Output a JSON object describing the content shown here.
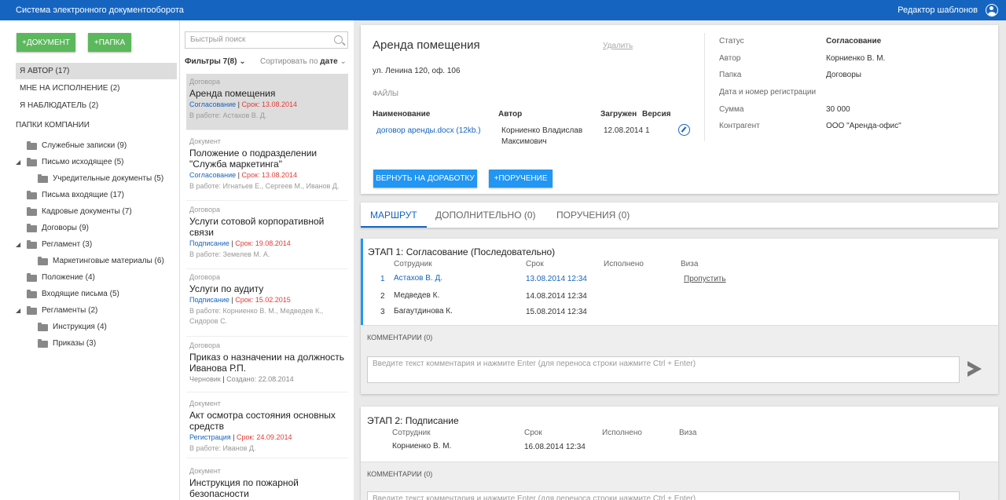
{
  "app": {
    "title": "Система электронного документооборота",
    "template_editor": "Редактор шаблонов"
  },
  "colors": {
    "primary": "#1565c0",
    "green": "#5cb85c",
    "accent": "#2196f3",
    "deadline": "#e53935"
  },
  "sidebar": {
    "add_document": "+ДОКУМЕНТ",
    "add_folder": "+ПАПКА",
    "nav": [
      "Я АВТОР (17)",
      "МНЕ НА ИСПОЛНЕНИЕ (2)",
      "Я НАБЛЮДАТЕЛЬ (2)"
    ],
    "section_title": "ПАПКИ КОМПАНИИ",
    "folders": [
      "Служебные записки (9)",
      "Письмо исходящее (5)",
      "Учредительные документы (5)",
      "Письма входящие (17)",
      "Кадровые документы (7)",
      "Договоры (9)",
      "Регламент (3)",
      "Маркетинговые материалы (6)",
      "Положение (4)",
      "Входящие письма (5)",
      "Регламенты (2)",
      "Инструкция (4)",
      "Приказы (3)"
    ]
  },
  "list": {
    "search_placeholder": "Быстрый поиск",
    "filters": "Фильтры 7(8)",
    "filters_caret": "⌄",
    "sort_label": "Сортировать по",
    "sort_field": "дате",
    "sort_caret": "⌄",
    "items": [
      {
        "type": "Договора",
        "title": "Аренда помещения",
        "status": "Согласование",
        "deadline": "Срок: 13.08.2014",
        "meta": "В работе: Астахов В. Д."
      },
      {
        "type": "Документ",
        "title": "Положение о подразделении \"Служба маркетинга\"",
        "status": "Согласование",
        "deadline": "Срок: 13.08.2014",
        "meta": "В работе: Игнатьев Е., Сергеев М., Иванов Д."
      },
      {
        "type": "Договора",
        "title": "Услуги сотовой корпоративной связи",
        "status": "Подписание",
        "deadline": "Срок: 19.08.2014",
        "meta": "В работе: Земелев М. А."
      },
      {
        "type": "Договора",
        "title": "Услуги по аудиту",
        "status": "Подписание",
        "deadline": "Срок: 15.02.2015",
        "meta": "В работе: Корниенко В. М., Медведев К., Сидоров С."
      },
      {
        "type": "Договора",
        "title": "Приказ о назначении на должность Иванова Р.П.",
        "status": "Черновик",
        "deadline": "Создано: 22.08.2014",
        "meta": ""
      },
      {
        "type": "Документ",
        "title": "Акт осмотра состояния основных средств",
        "status": "Регистрация",
        "deadline": "Срок: 24.09.2014",
        "meta": "В работе: Иванов Д."
      },
      {
        "type": "Документ",
        "title": "Инструкция по пожарной безопасности",
        "status": "",
        "deadline": "",
        "meta": ""
      }
    ]
  },
  "doc": {
    "title": "Аренда помещения",
    "delete": "Удалить",
    "address": "ул. Ленина 120, оф. 106",
    "files_label": "ФАЙЛЫ",
    "files_headers": {
      "name": "Наименование",
      "author": "Автор",
      "uploaded": "Загружен",
      "version": "Версия"
    },
    "file": {
      "name": "договор аренды.docx (12kb.)",
      "author": "Корниенко Владислав Максимович",
      "uploaded": "12.08.2014",
      "version": "1"
    },
    "return_btn": "ВЕРНУТЬ НА ДОРАБОТКУ",
    "task_btn": "+ПОРУЧЕНИЕ",
    "props": [
      {
        "label": "Статус",
        "value": "Согласование"
      },
      {
        "label": "Автор",
        "value": "Корниенко В. М."
      },
      {
        "label": "Папка",
        "value": "Договоры"
      },
      {
        "label": "Дата и номер регистрации",
        "value": ""
      },
      {
        "label": "Сумма",
        "value": "30 000"
      },
      {
        "label": "Контрагент",
        "value": "ООО \"Аренда-офис\""
      }
    ]
  },
  "tabs": [
    "МАРШРУТ",
    "ДОПОЛНИТЕЛЬНО (0)",
    "ПОРУЧЕНИЯ (0)"
  ],
  "route": {
    "headers": {
      "employee": "Сотрудник",
      "deadline": "Срок",
      "done": "Исполнено",
      "visa": "Виза"
    },
    "comments_label": "КОММЕНТАРИИ (0)",
    "comment_placeholder": "Введите текст комментария и нажмите Enter (для переноса строки нажмите Ctrl + Enter)",
    "stage1": {
      "title": "ЭТАП 1: Согласование (Последовательно)",
      "rows": [
        {
          "num": "1",
          "name": "Астахов В. Д.",
          "deadline": "13.08.2014 12:34",
          "action": "Пропустить"
        },
        {
          "num": "2",
          "name": "Медведев К.",
          "deadline": "14.08.2014 12:34",
          "action": ""
        },
        {
          "num": "3",
          "name": "Багаутдинова К.",
          "deadline": "15.08.2014 12:34",
          "action": ""
        }
      ]
    },
    "stage2": {
      "title": "ЭТАП 2: Подписание",
      "rows": [
        {
          "name": "Корниенко В. М.",
          "deadline": "16.08.2014 12:34"
        }
      ]
    }
  }
}
